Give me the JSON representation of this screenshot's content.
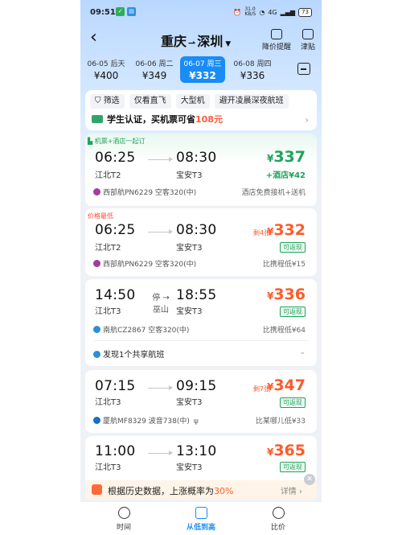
{
  "status": {
    "time": "09:51",
    "signal": "4G",
    "battery": "73",
    "speed": "31.0 KB/S"
  },
  "header": {
    "origin": "重庆",
    "destination": "深圳",
    "price_alert": "降价提醒",
    "stick": "津贴"
  },
  "dates": [
    {
      "date": "06-05",
      "day": "后天",
      "price": "¥400"
    },
    {
      "date": "06-06",
      "day": "周二",
      "price": "¥349"
    },
    {
      "date": "06-07",
      "day": "周三",
      "price": "¥332"
    },
    {
      "date": "06-08",
      "day": "周四",
      "price": "¥336"
    }
  ],
  "filters": [
    "筛选",
    "仅看直飞",
    "大型机",
    "避开凌晨深夜航班"
  ],
  "promo": {
    "text": "学生认证，买机票可省",
    "amount": "108元"
  },
  "flights": [
    {
      "tag": "机票+酒店一起订",
      "dep_time": "06:25",
      "dep_airport": "江北T2",
      "arr_time": "08:30",
      "arr_airport": "宝安T3",
      "price": "337",
      "extra": "+酒店¥42",
      "airline": "西部航PN6229  空客320(中)",
      "note": "酒店免费接机+送机"
    },
    {
      "tag": "价格最低",
      "dep_time": "06:25",
      "dep_airport": "江北T2",
      "arr_time": "08:30",
      "arr_airport": "宝安T3",
      "price": "332",
      "left": "剩4张",
      "badge": "可返现",
      "airline": "西部航PN6229 空客320(中)",
      "note": "比携程低¥15"
    },
    {
      "dep_time": "14:50",
      "dep_airport": "江北T3",
      "arr_time": "18:55",
      "arr_airport": "宝安T3",
      "stop": "停",
      "stop_city": "巫山",
      "price": "336",
      "badge": "可返现",
      "airline": "南航CZ2867 空客320(中)",
      "note": "比携程低¥64",
      "shared": "发现1个共享航班"
    },
    {
      "dep_time": "07:15",
      "dep_airport": "江北T3",
      "arr_time": "09:15",
      "arr_airport": "宝安T3",
      "price": "347",
      "left": "剩7张",
      "badge": "可返现",
      "airline": "厦航MF8329 波音738(中)",
      "note": "比某哪儿低¥33"
    },
    {
      "dep_time": "11:00",
      "dep_airport": "江北T3",
      "arr_time": "13:10",
      "arr_airport": "宝安T3",
      "price": "365",
      "badge": "可返现"
    }
  ],
  "banner": {
    "text": "根据历史数据，上涨概率为",
    "percent": "30%",
    "more": "详情"
  },
  "tabs": [
    "时间",
    "从低到高",
    "比价"
  ],
  "currency": "¥",
  "colors": {
    "accent": "#1a8cf5",
    "price": "#ff5a2a",
    "green": "#1fa35b"
  }
}
